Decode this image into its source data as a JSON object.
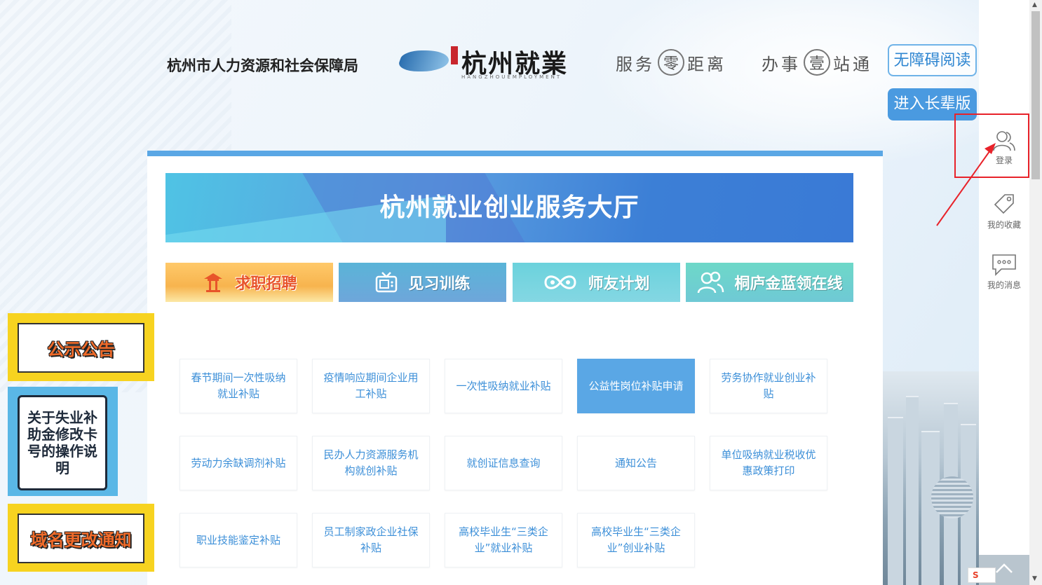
{
  "header": {
    "org_title": "杭州市人力资源和社会保障局",
    "logo_name": "杭州就業",
    "logo_sub": "HANGZHOUEMPLOYMENT",
    "slogan_1": {
      "pre": "服务",
      "circle": "零",
      "post": "距离"
    },
    "slogan_2": {
      "pre": "办事",
      "circle": "壹",
      "post": "站通"
    },
    "accessibility_button": "无障碍阅读",
    "elder_button": "进入长辈版"
  },
  "sidebar": {
    "login": "登录",
    "favorites": "我的收藏",
    "messages": "我的消息"
  },
  "main": {
    "banner_title": "杭州就业创业服务大厅",
    "tabs": [
      {
        "label": "求职招聘",
        "icon": "pavilion-icon"
      },
      {
        "label": "见习训练",
        "icon": "tv-icon"
      },
      {
        "label": "师友计划",
        "icon": "infinity-icon"
      },
      {
        "label": "桐庐金蓝领在线",
        "icon": "people-icon"
      }
    ],
    "services": [
      "春节期间一次性吸纳就业补贴",
      "疫情响应期间企业用工补贴",
      "一次性吸纳就业补贴",
      "公益性岗位补贴申请",
      "劳务协作就业创业补贴",
      "劳动力余缺调剂补贴",
      "民办人力资源服务机构就创补贴",
      "就创证信息查询",
      "通知公告",
      "单位吸纳就业税收优惠政策打印",
      "职业技能鉴定补贴",
      "员工制家政企业社保补贴",
      "高校毕业生“三类企业”就业补贴",
      "高校毕业生“三类企业”创业补贴"
    ],
    "active_service_index": 3
  },
  "notices": {
    "public": "公示公告",
    "card_change": "关于失业补助金修改卡号的操作说明",
    "domain_change": "域名更改通知"
  },
  "colors": {
    "accent": "#5aa7e5",
    "highlight": "#e8222a",
    "service_text": "#3c8fd8"
  }
}
